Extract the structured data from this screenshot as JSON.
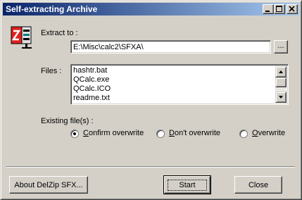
{
  "window": {
    "title": "Self-extracting Archive"
  },
  "extract": {
    "label": "Extract to :",
    "path": "E:\\Misc\\calc2\\SFXA\\",
    "browse_label": "..."
  },
  "files": {
    "label": "Files :",
    "items": [
      "hashtr.bat",
      "QCalc.exe",
      "QCalc.ICO",
      "readme.txt"
    ]
  },
  "existing": {
    "label": "Existing file(s) :",
    "options": [
      {
        "first": "C",
        "rest": "onfirm overwrite",
        "selected": true
      },
      {
        "first": "D",
        "rest": "on't overwrite",
        "selected": false
      },
      {
        "first": "O",
        "rest": "verwrite",
        "selected": false
      }
    ]
  },
  "buttons": {
    "about": "About DelZip SFX...",
    "start": "Start",
    "close": "Close"
  },
  "colors": {
    "face": "#d4d0c8",
    "title_start": "#0a246a",
    "title_end": "#a6caf0",
    "icon_red": "#e02020",
    "icon_teal": "#008080"
  },
  "icons": [
    "zip-archive-icon",
    "minimize-icon",
    "maximize-icon",
    "close-icon",
    "scroll-up-arrow-icon",
    "scroll-down-arrow-icon"
  ]
}
